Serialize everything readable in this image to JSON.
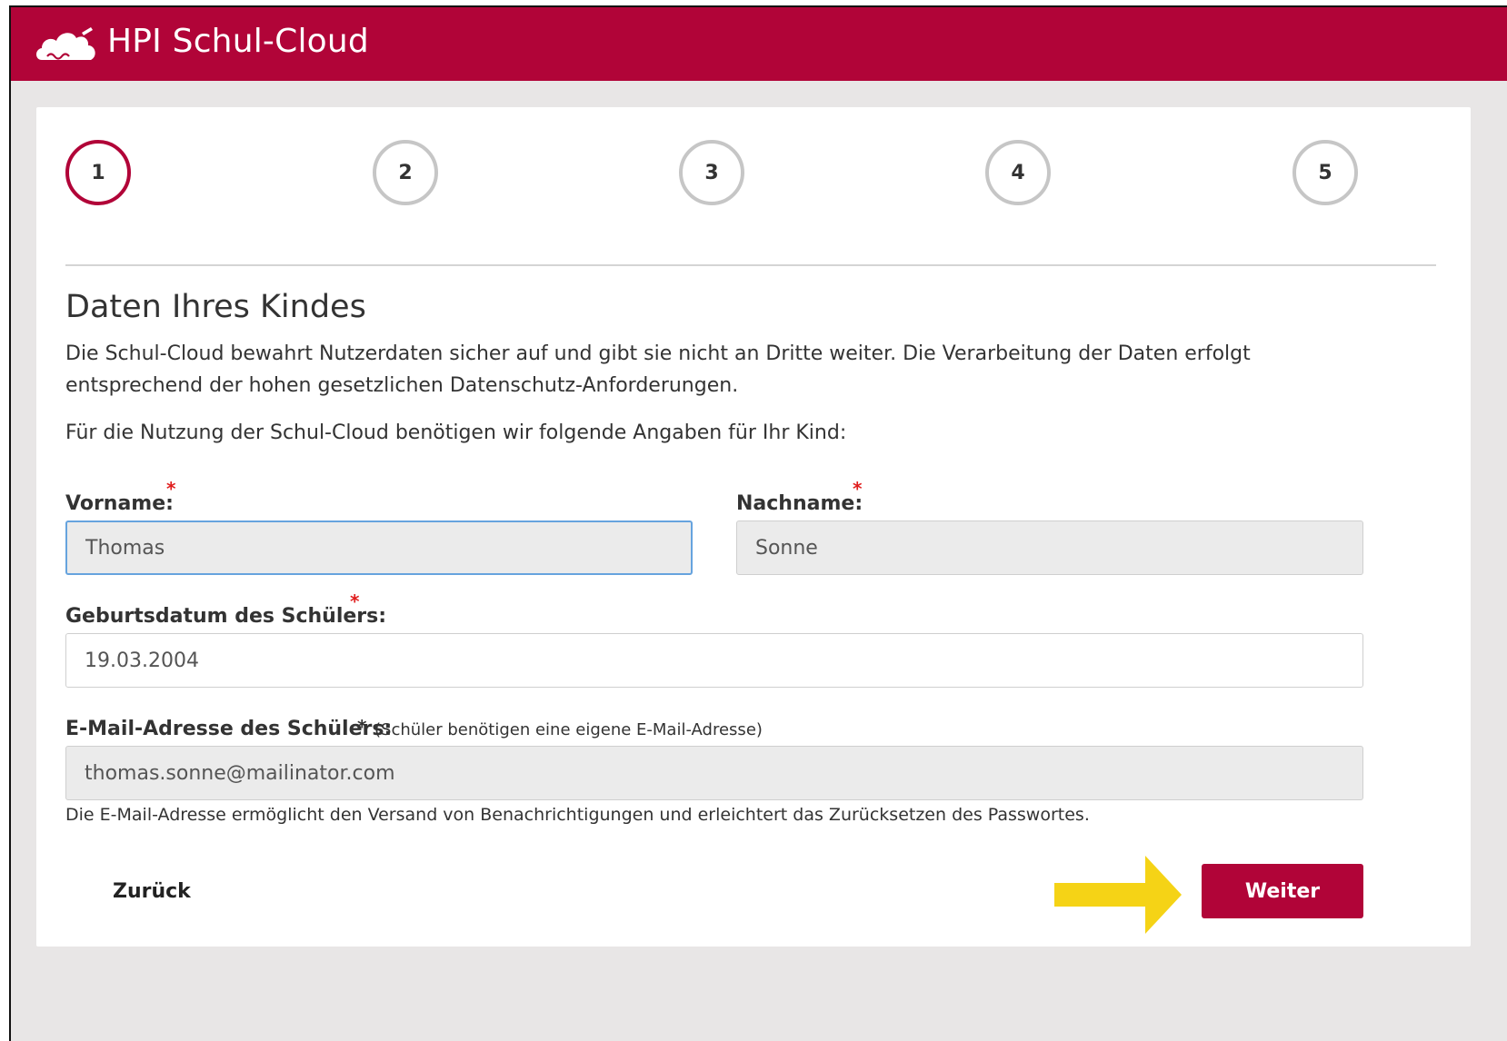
{
  "header": {
    "title": "HPI Schul-Cloud",
    "logo_icon": "cloud-logo-icon",
    "bar_color": "#b10438"
  },
  "steps": [
    {
      "label": "1",
      "state": "active"
    },
    {
      "label": "2",
      "state": "inactive"
    },
    {
      "label": "3",
      "state": "inactive"
    },
    {
      "label": "4",
      "state": "inactive"
    },
    {
      "label": "5",
      "state": "inactive"
    }
  ],
  "form": {
    "heading": "Daten Ihres Kindes",
    "intro_line1": "Die Schul-Cloud bewahrt Nutzerdaten sicher auf und gibt sie nicht an Dritte weiter. Die Verarbeitung der Daten erfolgt",
    "intro_line2": "entsprechend der hohen gesetzlichen Datenschutz-Anforderungen.",
    "instruction": "Für die Nutzung der Schul-Cloud benötigen wir folgende Angaben für Ihr Kind:",
    "required_marker": "*",
    "firstname": {
      "label": "Vorname:",
      "value": "Thomas"
    },
    "lastname": {
      "label": "Nachname:",
      "value": "Sonne"
    },
    "birthdate": {
      "label": "Geburtsdatum des Schülers:",
      "value": "19.03.2004"
    },
    "email": {
      "label": "E-Mail-Adresse des Schülers:",
      "note": "(Schüler benötigen eine eigene E-Mail-Adresse)",
      "value": "thomas.sonne@mailinator.com",
      "help": "Die E-Mail-Adresse ermöglicht den Versand von Benachrichtigungen und erleichtert das Zurücksetzen des Passwortes."
    }
  },
  "actions": {
    "back_label": "Zurück",
    "next_label": "Weiter",
    "arrow_icon": "arrow-right-icon",
    "arrow_color": "#f5d316"
  }
}
